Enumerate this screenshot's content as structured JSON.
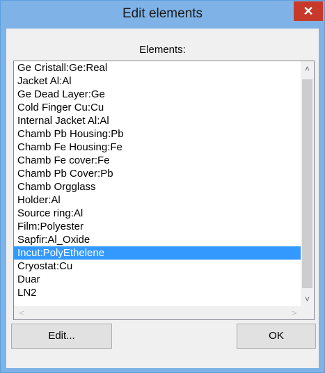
{
  "window": {
    "title": "Edit elements"
  },
  "elements_label": "Elements:",
  "list": {
    "items": [
      "Ge Cristall:Ge:Real",
      "Jacket Al:Al",
      "Ge Dead Layer:Ge",
      "Cold Finger Cu:Cu",
      "Internal Jacket Al:Al",
      "Chamb Pb Housing:Pb",
      "Chamb Fe Housing:Fe",
      "Chamb Fe cover:Fe",
      "Chamb Pb Cover:Pb",
      "Chamb Orgglass",
      "Holder:Al",
      "Source ring:Al",
      "Film:Polyester",
      "Sapfir:Al_Oxide",
      "Incut:PolyEthelene",
      "Cryostat:Cu",
      "Duar",
      "LN2"
    ],
    "selected_index": 14
  },
  "buttons": {
    "edit": "Edit...",
    "ok": "OK"
  },
  "icons": {
    "close": "close-icon",
    "scroll_up": "chevron-up-icon",
    "scroll_down": "chevron-down-icon",
    "scroll_left": "chevron-left-icon",
    "scroll_right": "chevron-right-icon"
  },
  "colors": {
    "titlebar": "#7fb2e6",
    "close": "#c7392b",
    "selection": "#3399ff"
  }
}
